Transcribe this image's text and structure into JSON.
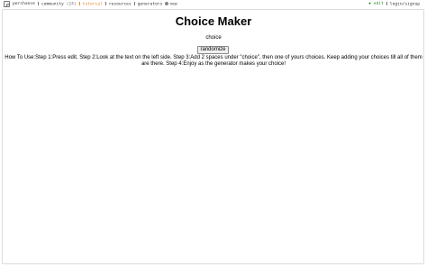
{
  "topbar": {
    "brand": "perchance",
    "community": "community",
    "community_count": "(24)",
    "tutorial": "tutorial",
    "resources": "resources",
    "generators": "generators",
    "new": "new",
    "edit": "edit",
    "login": "login/signup"
  },
  "main": {
    "title": "Choice Maker",
    "choice_text": "choice",
    "randomize_label": "randomize",
    "instructions": "How To Use:Step 1:Press edit. Step 2:Look at the text on the left side. Step 3:Add 2 spaces under \"choice\", then one of yours choices. Keep adding your choices till all of them are there. Step 4:Enjoy as the generator makes your choice!"
  },
  "colors": {
    "tutorial": "#e08a2c",
    "edit": "#2a8a2a"
  }
}
